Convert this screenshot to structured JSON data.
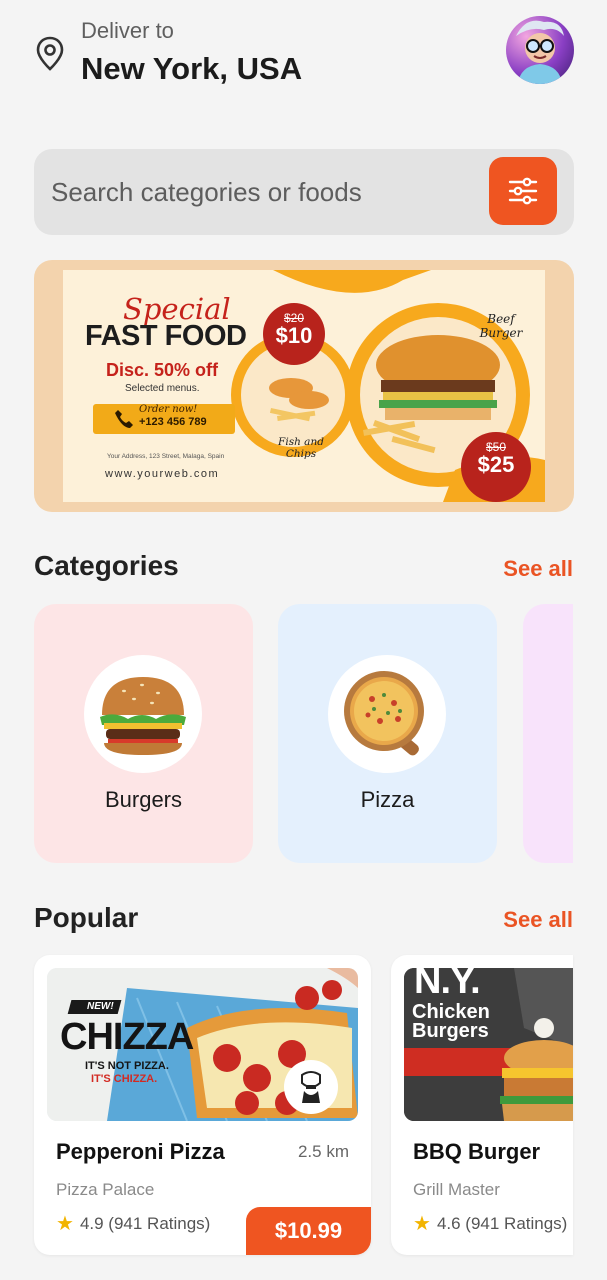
{
  "header": {
    "deliver_label": "Deliver to",
    "location": "New York, USA"
  },
  "search": {
    "placeholder": "Search categories or foods"
  },
  "banner": {
    "special": "Special",
    "title": "FAST FOOD",
    "discount": "Disc. 50% off",
    "selected": "Selected menus.",
    "order_now": "Order now!",
    "phone": "+123 456 789",
    "address": "Your Address, 123 Street, Malaga, Spain",
    "website": "www.yourweb.com",
    "price1_old": "$20",
    "price1_new": "$10",
    "price2_old": "$50",
    "price2_new": "$25",
    "beef_burger": "Beef Burger",
    "fish_chips": "Fish and Chips"
  },
  "categories": {
    "title": "Categories",
    "see_all": "See all",
    "items": [
      {
        "label": "Burgers",
        "bg": "#fde5e6"
      },
      {
        "label": "Pizza",
        "bg": "#e4f0fd"
      },
      {
        "label": "",
        "bg": "#f8e3fb"
      }
    ]
  },
  "popular": {
    "title": "Popular",
    "see_all": "See all",
    "items": [
      {
        "name": "Pepperoni Pizza",
        "distance": "2.5 km",
        "restaurant": "Pizza Palace",
        "rating": "4.9 (941 Ratings)",
        "price": "$10.99",
        "image_text": {
          "new": "NEW!",
          "brand": "CHIZZA",
          "tag1": "IT'S NOT PIZZA.",
          "tag2": "IT'S CHIZZA."
        }
      },
      {
        "name": "BBQ Burger",
        "distance": "",
        "restaurant": "Grill Master",
        "rating": "4.6 (941 Ratings)",
        "price": "",
        "image_text": {
          "ny": "N.Y.",
          "chicken": "Chicken",
          "burgers": "Burgers"
        }
      }
    ]
  },
  "colors": {
    "accent": "#ef5521",
    "background": "#f4f4f4"
  }
}
